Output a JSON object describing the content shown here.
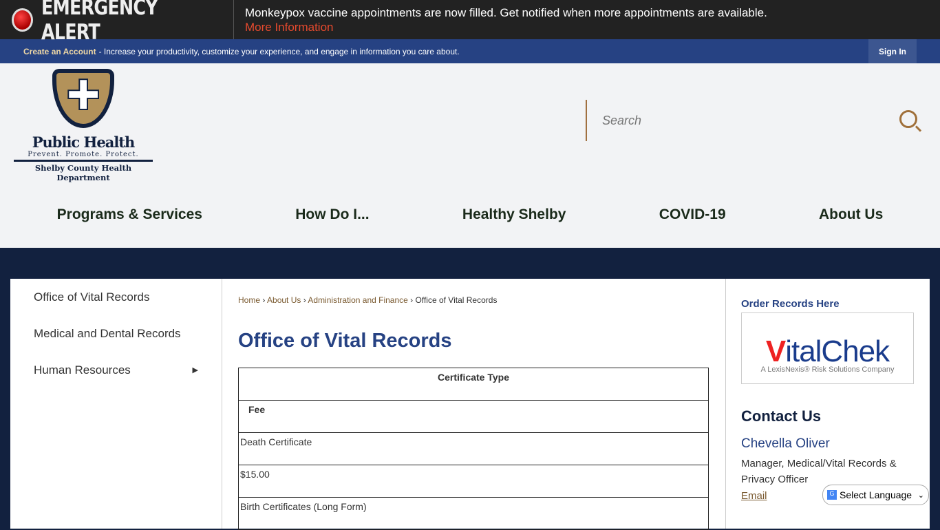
{
  "alert": {
    "title": "EMERGENCY ALERT",
    "message": "Monkeypox vaccine appointments are now filled. Get notified when more appointments are available.",
    "link": "More Information"
  },
  "account": {
    "create": "Create an Account",
    "text": "- Increase your productivity, customize your experience, and engage in information you care about.",
    "signin": "Sign In"
  },
  "logo": {
    "title": "Public Health",
    "tagline": "Prevent. Promote. Protect.",
    "dept": "Shelby County Health Department"
  },
  "search": {
    "placeholder": "Search"
  },
  "nav": [
    "Programs & Services",
    "How Do I...",
    "Healthy Shelby",
    "COVID-19",
    "About Us"
  ],
  "sidebar": [
    "Office of Vital Records",
    "Medical and Dental Records",
    "Human Resources"
  ],
  "breadcrumb": [
    "Home",
    "About Us",
    "Administration and Finance",
    "Office of Vital Records"
  ],
  "page_title": "Office of Vital Records",
  "table": {
    "header": "Certificate Type",
    "rows": [
      "Fee",
      "Death Certificate",
      "$15.00",
      "Birth Certificates (Long Form)"
    ]
  },
  "right": {
    "order": "Order Records Here",
    "vitalchek": "VitalChek",
    "vitalchek_sub": "A LexisNexis® Risk Solutions Company",
    "contact": "Contact Us",
    "name": "Chevella Oliver",
    "role": "Manager, Medical/Vital Records & Privacy Officer",
    "email": "Email"
  },
  "language": "Select Language"
}
